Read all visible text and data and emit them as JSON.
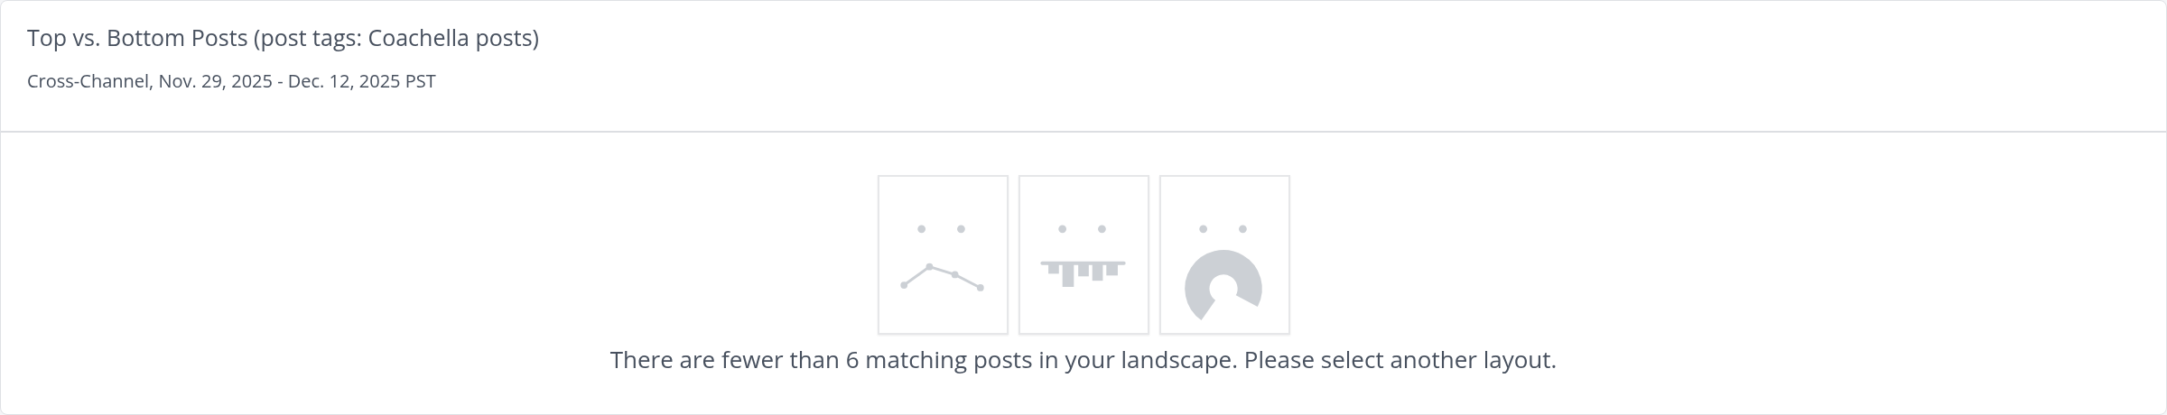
{
  "header": {
    "title": "Top vs. Bottom Posts (post tags: Coachella posts)",
    "subtitle": "Cross-Channel, Nov. 29, 2025 - Dec. 12, 2025 PST"
  },
  "empty_state": {
    "illustrations": [
      {
        "kind": "line"
      },
      {
        "kind": "bar"
      },
      {
        "kind": "donut"
      }
    ],
    "message": "There are fewer than 6 matching posts in your landscape. Please select another layout."
  }
}
